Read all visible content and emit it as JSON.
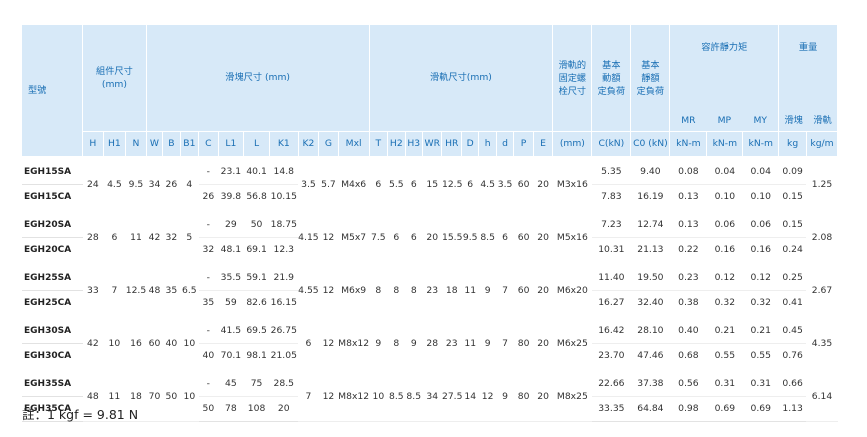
{
  "headers": {
    "model": "型號",
    "assembly": "組件尺寸\n(mm)",
    "block": "滑塊尺寸 (mm)",
    "rail": "滑軌尺寸(mm)",
    "mount_bolt": "滑軌的\n固定螺\n栓尺寸",
    "dyn_load": "基本\n動額\n定負荷",
    "stat_load": "基本\n靜額\n定負荷",
    "moment": "容許靜力矩",
    "weight": "重量",
    "mr": "MR",
    "mp": "MP",
    "my": "MY",
    "block_w": "滑塊",
    "rail_w": "滑軌",
    "sub": [
      "H",
      "H1",
      "N",
      "W",
      "B",
      "B1",
      "C",
      "L1",
      "L",
      "K1",
      "K2",
      "G",
      "Mxl",
      "T",
      "H2",
      "H3",
      "WR",
      "HR",
      "D",
      "h",
      "d",
      "P",
      "E",
      "(mm)",
      "C(kN)",
      "C0 (kN)",
      "kN-m",
      "kN-m",
      "kN-m",
      "kg",
      "kg/m"
    ]
  },
  "groups": [
    {
      "sa": "EGH15SA",
      "ca": "EGH15CA",
      "H": "24",
      "H1": "4.5",
      "N": "9.5",
      "W": "34",
      "B": "26",
      "B1": "4",
      "C_sa": "-",
      "L1_sa": "23.1",
      "L_sa": "40.1",
      "K1_sa": "14.8",
      "C_ca": "26",
      "L1_ca": "39.8",
      "L_ca": "56.8",
      "K1_ca": "10.15",
      "K2": "3.5",
      "G": "5.7",
      "Mxl": "M4x6",
      "T": "6",
      "H2": "5.5",
      "H3": "6",
      "WR": "15",
      "HR": "12.5",
      "D": "6",
      "h": "4.5",
      "d": "3.5",
      "P": "60",
      "E": "20",
      "bolt": "M3x16",
      "C_kn_sa": "5.35",
      "C0_sa": "9.40",
      "MR_sa": "0.08",
      "MP_sa": "0.04",
      "MY_sa": "0.04",
      "kg_sa": "0.09",
      "C_kn_ca": "7.83",
      "C0_ca": "16.19",
      "MR_ca": "0.13",
      "MP_ca": "0.10",
      "MY_ca": "0.10",
      "kg_ca": "0.15",
      "kgm": "1.25"
    },
    {
      "sa": "EGH20SA",
      "ca": "EGH20CA",
      "H": "28",
      "H1": "6",
      "N": "11",
      "W": "42",
      "B": "32",
      "B1": "5",
      "C_sa": "-",
      "L1_sa": "29",
      "L_sa": "50",
      "K1_sa": "18.75",
      "C_ca": "32",
      "L1_ca": "48.1",
      "L_ca": "69.1",
      "K1_ca": "12.3",
      "K2": "4.15",
      "G": "12",
      "Mxl": "M5x7",
      "T": "7.5",
      "H2": "6",
      "H3": "6",
      "WR": "20",
      "HR": "15.5",
      "D": "9.5",
      "h": "8.5",
      "d": "6",
      "P": "60",
      "E": "20",
      "bolt": "M5x16",
      "C_kn_sa": "7.23",
      "C0_sa": "12.74",
      "MR_sa": "0.13",
      "MP_sa": "0.06",
      "MY_sa": "0.06",
      "kg_sa": "0.15",
      "C_kn_ca": "10.31",
      "C0_ca": "21.13",
      "MR_ca": "0.22",
      "MP_ca": "0.16",
      "MY_ca": "0.16",
      "kg_ca": "0.24",
      "kgm": "2.08"
    },
    {
      "sa": "EGH25SA",
      "ca": "EGH25CA",
      "H": "33",
      "H1": "7",
      "N": "12.5",
      "W": "48",
      "B": "35",
      "B1": "6.5",
      "C_sa": "-",
      "L1_sa": "35.5",
      "L_sa": "59.1",
      "K1_sa": "21.9",
      "C_ca": "35",
      "L1_ca": "59",
      "L_ca": "82.6",
      "K1_ca": "16.15",
      "K2": "4.55",
      "G": "12",
      "Mxl": "M6x9",
      "T": "8",
      "H2": "8",
      "H3": "8",
      "WR": "23",
      "HR": "18",
      "D": "11",
      "h": "9",
      "d": "7",
      "P": "60",
      "E": "20",
      "bolt": "M6x20",
      "C_kn_sa": "11.40",
      "C0_sa": "19.50",
      "MR_sa": "0.23",
      "MP_sa": "0.12",
      "MY_sa": "0.12",
      "kg_sa": "0.25",
      "C_kn_ca": "16.27",
      "C0_ca": "32.40",
      "MR_ca": "0.38",
      "MP_ca": "0.32",
      "MY_ca": "0.32",
      "kg_ca": "0.41",
      "kgm": "2.67"
    },
    {
      "sa": "EGH30SA",
      "ca": "EGH30CA",
      "H": "42",
      "H1": "10",
      "N": "16",
      "W": "60",
      "B": "40",
      "B1": "10",
      "C_sa": "-",
      "L1_sa": "41.5",
      "L_sa": "69.5",
      "K1_sa": "26.75",
      "C_ca": "40",
      "L1_ca": "70.1",
      "L_ca": "98.1",
      "K1_ca": "21.05",
      "K2": "6",
      "G": "12",
      "Mxl": "M8x12",
      "T": "9",
      "H2": "8",
      "H3": "9",
      "WR": "28",
      "HR": "23",
      "D": "11",
      "h": "9",
      "d": "7",
      "P": "80",
      "E": "20",
      "bolt": "M6x25",
      "C_kn_sa": "16.42",
      "C0_sa": "28.10",
      "MR_sa": "0.40",
      "MP_sa": "0.21",
      "MY_sa": "0.21",
      "kg_sa": "0.45",
      "C_kn_ca": "23.70",
      "C0_ca": "47.46",
      "MR_ca": "0.68",
      "MP_ca": "0.55",
      "MY_ca": "0.55",
      "kg_ca": "0.76",
      "kgm": "4.35"
    },
    {
      "sa": "EGH35SA",
      "ca": "EGH35CA",
      "H": "48",
      "H1": "11",
      "N": "18",
      "W": "70",
      "B": "50",
      "B1": "10",
      "C_sa": "-",
      "L1_sa": "45",
      "L_sa": "75",
      "K1_sa": "28.5",
      "C_ca": "50",
      "L1_ca": "78",
      "L_ca": "108",
      "K1_ca": "20",
      "K2": "7",
      "G": "12",
      "Mxl": "M8x12",
      "T": "10",
      "H2": "8.5",
      "H3": "8.5",
      "WR": "34",
      "HR": "27.5",
      "D": "14",
      "h": "12",
      "d": "9",
      "P": "80",
      "E": "20",
      "bolt": "M8x25",
      "C_kn_sa": "22.66",
      "C0_sa": "37.38",
      "MR_sa": "0.56",
      "MP_sa": "0.31",
      "MY_sa": "0.31",
      "kg_sa": "0.66",
      "C_kn_ca": "33.35",
      "C0_ca": "64.84",
      "MR_ca": "0.98",
      "MP_ca": "0.69",
      "MY_ca": "0.69",
      "kg_ca": "1.13",
      "kgm": "6.14"
    }
  ],
  "note": "註：1 kgf = 9.81 N"
}
